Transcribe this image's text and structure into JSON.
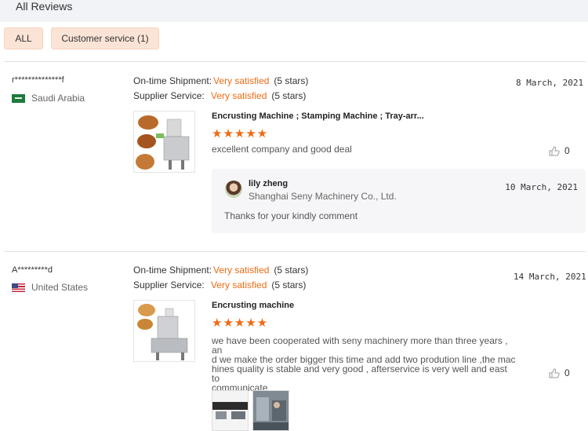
{
  "header": {
    "title": "All Reviews"
  },
  "filters": [
    {
      "label": "ALL"
    },
    {
      "label": "Customer service (1)"
    }
  ],
  "reviews": [
    {
      "user": "r**************f",
      "country": "Saudi Arabia",
      "flag_icon": "saudi-arabia-flag-icon",
      "shipment_label": "On-time Shipment:",
      "shipment_value": "Very satisfied",
      "shipment_stars": "(5 stars)",
      "service_label": "Supplier Service:",
      "service_value": "Very satisfied",
      "service_stars": "(5 stars)",
      "date": "8 March, 2021",
      "product": "Encrusting Machine ; Stamping Machine ; Tray-arr...",
      "stars": "★★★★★",
      "comment": "excellent company and good deal",
      "likes": "0",
      "reply": {
        "name": "lily zheng",
        "company": "Shanghai Seny Machinery Co., Ltd.",
        "date": "10 March, 2021",
        "text": "Thanks for your kindly comment"
      }
    },
    {
      "user": "A*********d",
      "country": "United States",
      "flag_icon": "united-states-flag-icon",
      "shipment_label": "On-time Shipment:",
      "shipment_value": "Very satisfied",
      "shipment_stars": "(5 stars)",
      "service_label": "Supplier Service:",
      "service_value": "Very satisfied",
      "service_stars": "(5 stars)",
      "date": "14 March, 2021",
      "product": "Encrusting machine",
      "stars": "★★★★★",
      "comment_lines": [
        "we have been cooperated with seny machinery more than three years , an",
        "d we make the order bigger this time and add two prodution line ,the mac",
        "hines quality is stable and very good , afterservice is very well and east to",
        "communicate"
      ],
      "likes": "0"
    }
  ],
  "colors": {
    "accent": "#f16a13",
    "filter_bg": "#fbe4d6",
    "header_bg": "#f2f3f7",
    "reply_bg": "#f6f6f8"
  }
}
